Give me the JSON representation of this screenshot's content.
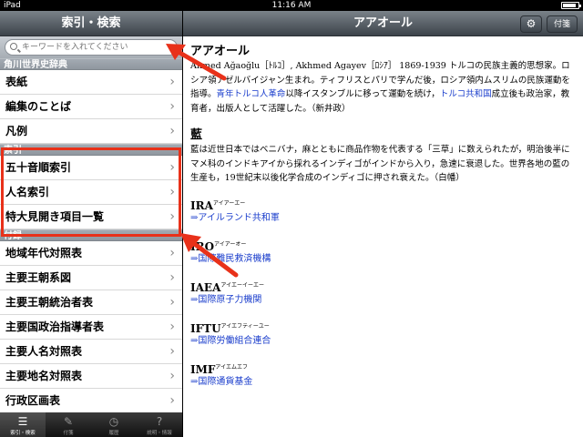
{
  "status": {
    "carrier": "iPad",
    "time": "11:16 AM"
  },
  "left": {
    "title": "索引・検索",
    "search_placeholder": "キーワードを入れてください",
    "sections": [
      {
        "header": "角川世界史辞典",
        "items": [
          "表紙",
          "編集のことば",
          "凡例"
        ]
      },
      {
        "header": "索引",
        "items": [
          "五十音順索引",
          "人名索引",
          "特大見開き項目一覧"
        ]
      },
      {
        "header": "付録",
        "items": [
          "地域年代対照表",
          "主要王朝系図",
          "主要王朝統治者表",
          "主要国政治指導者表",
          "主要人名対照表",
          "主要地名対照表",
          "行政区画表"
        ]
      }
    ],
    "tabs": [
      {
        "label": "索引・検索",
        "icon": "list-icon"
      },
      {
        "label": "付箋",
        "icon": "pencil-icon"
      },
      {
        "label": "履歴",
        "icon": "clock-icon"
      },
      {
        "label": "説明・情報",
        "icon": "question-icon"
      }
    ]
  },
  "right": {
    "title": "アアオール",
    "fusen_label": "付箋",
    "entries": [
      {
        "title": "アアオール",
        "body_pre": "Ahmed Ağaoğlu［ﾄﾙｺ］, Akhmed Agayev［ﾛｼｱ］ 1869-1939 トルコの民族主義的思想家。ロシア領アゼルバイジャン生まれ。ティフリスとパリで学んだ後，ロシア領内ムスリムの民族運動を指導。",
        "link1": "青年トルコ人革命",
        "body_mid": "以降イスタンブルに移って運動を続け，",
        "link2": "トルコ共和国",
        "body_post": "成立後も政治家，教育者，出版人として活躍した。（新井政）"
      },
      {
        "title": "藍",
        "body": "藍は近世日本ではベニバナ，麻とともに商品作物を代表する「三草」に数えられたが，明治後半にマメ科のインドキアイから採れるインディゴがインドから入り，急速に衰退した。世界各地の藍の生産も，19世紀末以後化学合成のインディゴに押され衰えた。（白幡）"
      }
    ],
    "abbrs": [
      {
        "term": "IRA",
        "reading": "アイアーエー",
        "ref": "⇒アイルランド共和軍"
      },
      {
        "term": "IRO",
        "reading": "アイアーオー",
        "ref": "⇒国際難民救済機構"
      },
      {
        "term": "IAEA",
        "reading": "アイエーイーエー",
        "ref": "⇒国際原子力機関"
      },
      {
        "term": "IFTU",
        "reading": "アイエフティーユー",
        "ref": "⇒国際労働組合連合"
      },
      {
        "term": "IMF",
        "reading": "アイエムエフ",
        "ref": "⇒国際通貨基金"
      }
    ]
  },
  "colors": {
    "annotation": "#e8311a",
    "link": "#1a3dcc"
  }
}
